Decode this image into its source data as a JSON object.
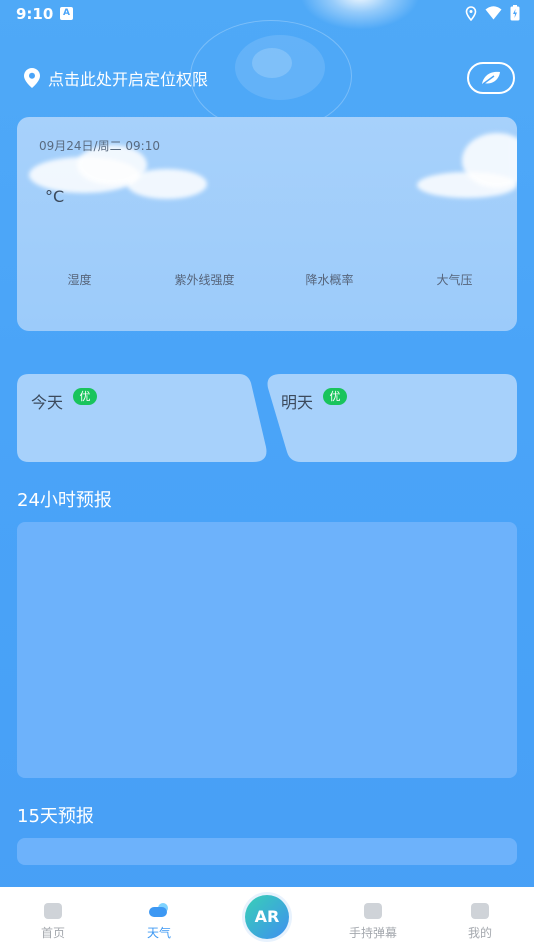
{
  "status_bar": {
    "time": "9:10",
    "notification_icon": "A"
  },
  "location": {
    "text": "点击此处开启定位权限"
  },
  "weather_card": {
    "date": "09月24日/周二 09:10",
    "temp_unit": "°C",
    "metrics": [
      "湿度",
      "紫外线强度",
      "降水概率",
      "大气压"
    ]
  },
  "today": {
    "label": "今天",
    "aqi": "优"
  },
  "tomorrow": {
    "label": "明天",
    "aqi": "优"
  },
  "sections": {
    "hourly_title": "24小时预报",
    "daily_title": "15天预报"
  },
  "nav": {
    "items": [
      {
        "label": "首页",
        "icon": "home-icon"
      },
      {
        "label": "天气",
        "icon": "weather-icon"
      },
      {
        "label": "手持弹幕",
        "icon": "danmaku-icon"
      },
      {
        "label": "我的",
        "icon": "profile-icon"
      }
    ],
    "ar_label": "AR",
    "active_color": "#3d98f3",
    "inactive_color": "#a4a8ae"
  },
  "colors": {
    "background": "#4aa4f8",
    "aqi_good": "#19c45c",
    "card": "#a7d1fb"
  }
}
